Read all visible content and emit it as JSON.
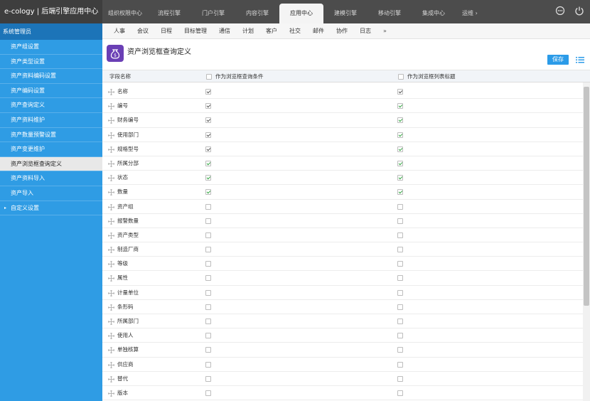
{
  "app": {
    "title": "e-cology | 后端引擎应用中心"
  },
  "topnav": [
    {
      "label": "组织权限中心"
    },
    {
      "label": "流程引擎"
    },
    {
      "label": "门户引擎"
    },
    {
      "label": "内容引擎"
    },
    {
      "label": "应用中心",
      "active": true
    },
    {
      "label": "建模引擎"
    },
    {
      "label": "移动引擎"
    },
    {
      "label": "集成中心"
    },
    {
      "label": "运维 ›"
    }
  ],
  "sidebar": {
    "title": "系统管理员",
    "items": [
      {
        "label": "资产组设置"
      },
      {
        "label": "资产类型设置"
      },
      {
        "label": "资产资料编码设置"
      },
      {
        "label": "资产编码设置"
      },
      {
        "label": "资产查询定义"
      },
      {
        "label": "资产资料维护"
      },
      {
        "label": "资产数量预警设置"
      },
      {
        "label": "资产变更维护"
      },
      {
        "label": "资产浏览框查询定义",
        "active": true
      },
      {
        "label": "资产资料导入"
      },
      {
        "label": "资产导入"
      },
      {
        "label": "自定义设置",
        "group": true,
        "arrow": "▸"
      }
    ]
  },
  "subtabs": {
    "items": [
      "人事",
      "会议",
      "日程",
      "目标管理",
      "通信",
      "计划",
      "客户",
      "社交",
      "邮件",
      "协作",
      "日志"
    ],
    "more": "»"
  },
  "page": {
    "title": "资产浏览框查询定义",
    "save_label": "保存"
  },
  "table": {
    "columns": [
      "字段名称",
      "作为浏览框查询条件",
      "作为浏览框列表标题"
    ],
    "rows": [
      {
        "name": "名称",
        "query": true,
        "query_color": "gray",
        "title": true,
        "title_color": "gray"
      },
      {
        "name": "编号",
        "query": true,
        "query_color": "gray",
        "title": true,
        "title_color": "green"
      },
      {
        "name": "财务编号",
        "query": true,
        "query_color": "gray",
        "title": true,
        "title_color": "green"
      },
      {
        "name": "使用部门",
        "query": true,
        "query_color": "gray",
        "title": true,
        "title_color": "green"
      },
      {
        "name": "规格型号",
        "query": true,
        "query_color": "gray",
        "title": true,
        "title_color": "green"
      },
      {
        "name": "所属分部",
        "query": true,
        "query_color": "green",
        "title": true,
        "title_color": "green"
      },
      {
        "name": "状态",
        "query": true,
        "query_color": "green",
        "title": true,
        "title_color": "green"
      },
      {
        "name": "数量",
        "query": true,
        "query_color": "green",
        "title": true,
        "title_color": "green"
      },
      {
        "name": "资产组",
        "query": false,
        "title": false
      },
      {
        "name": "报警数量",
        "query": false,
        "title": false
      },
      {
        "name": "资产类型",
        "query": false,
        "title": false
      },
      {
        "name": "制造厂商",
        "query": false,
        "title": false
      },
      {
        "name": "等级",
        "query": false,
        "title": false
      },
      {
        "name": "属性",
        "query": false,
        "title": false
      },
      {
        "name": "计量单位",
        "query": false,
        "title": false
      },
      {
        "name": "条形码",
        "query": false,
        "title": false
      },
      {
        "name": "所属部门",
        "query": false,
        "title": false
      },
      {
        "name": "使用人",
        "query": false,
        "title": false
      },
      {
        "name": "单独核算",
        "query": false,
        "title": false
      },
      {
        "name": "供应商",
        "query": false,
        "title": false
      },
      {
        "name": "替代",
        "query": false,
        "title": false
      },
      {
        "name": "版本",
        "query": false,
        "title": false
      }
    ]
  },
  "icons": {
    "help": "help-icon",
    "power": "power-icon",
    "list": "list-icon",
    "page": "money-bag-icon",
    "drag": "drag-handle-icon"
  },
  "colors": {
    "topbar": "#4c4c4c",
    "sidebar": "#2f9ce4",
    "sidebar_title": "#1c74b8",
    "accent": "#2b9be8",
    "check_green": "#37a845",
    "page_icon": "#6a3fb5"
  }
}
